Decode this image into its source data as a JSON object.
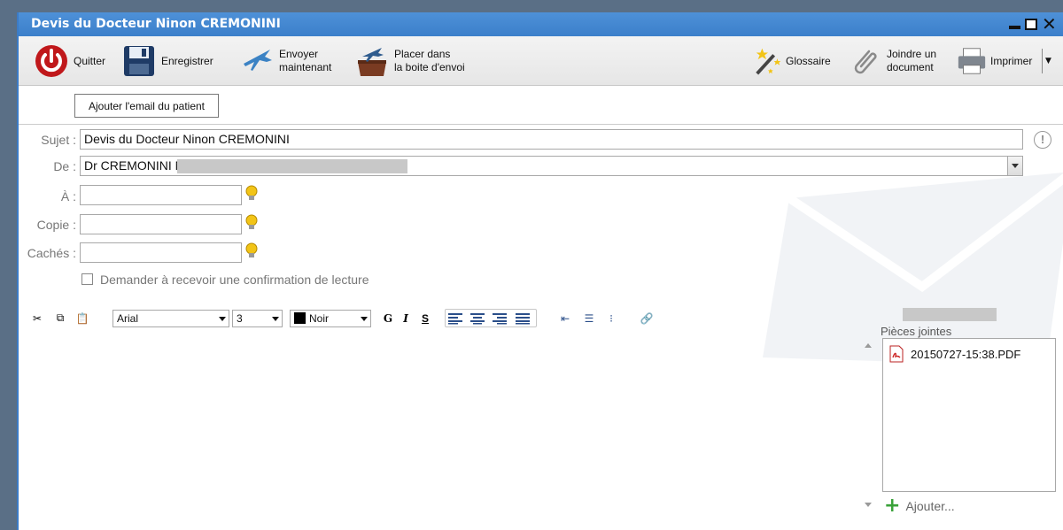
{
  "window": {
    "title": "Devis du Docteur Ninon CREMONINI"
  },
  "toolbar": {
    "quit": "Quitter",
    "save": "Enregistrer",
    "send_now": "Envoyer\nmaintenant",
    "outbox": "Placer dans\nla boite d'envoi",
    "glossary": "Glossaire",
    "attach": "Joindre un\ndocument",
    "print": "Imprimer"
  },
  "header": {
    "add_email_button": "Ajouter l'email du patient"
  },
  "form": {
    "subject_label": "Sujet :",
    "subject_value": "Devis du Docteur Ninon CREMONINI",
    "from_label": "De :",
    "from_value": "Dr CREMONINI Ninc",
    "to_label": "À :",
    "cc_label": "Copie :",
    "bcc_label": "Cachés :",
    "read_receipt_label": "Demander à recevoir une confirmation de lecture"
  },
  "format": {
    "font": "Arial",
    "size": "3",
    "color_name": "Noir",
    "color_hex": "#000000",
    "bold": "G",
    "italic": "I",
    "strike": "S"
  },
  "attachments": {
    "label": "Pièces jointes",
    "items": [
      "20150727-15:38.PDF"
    ],
    "add_label": "Ajouter..."
  },
  "colors": {
    "titlebar": "#3b7fca",
    "accent_green": "#3aa23a",
    "power_red": "#c0181b"
  }
}
